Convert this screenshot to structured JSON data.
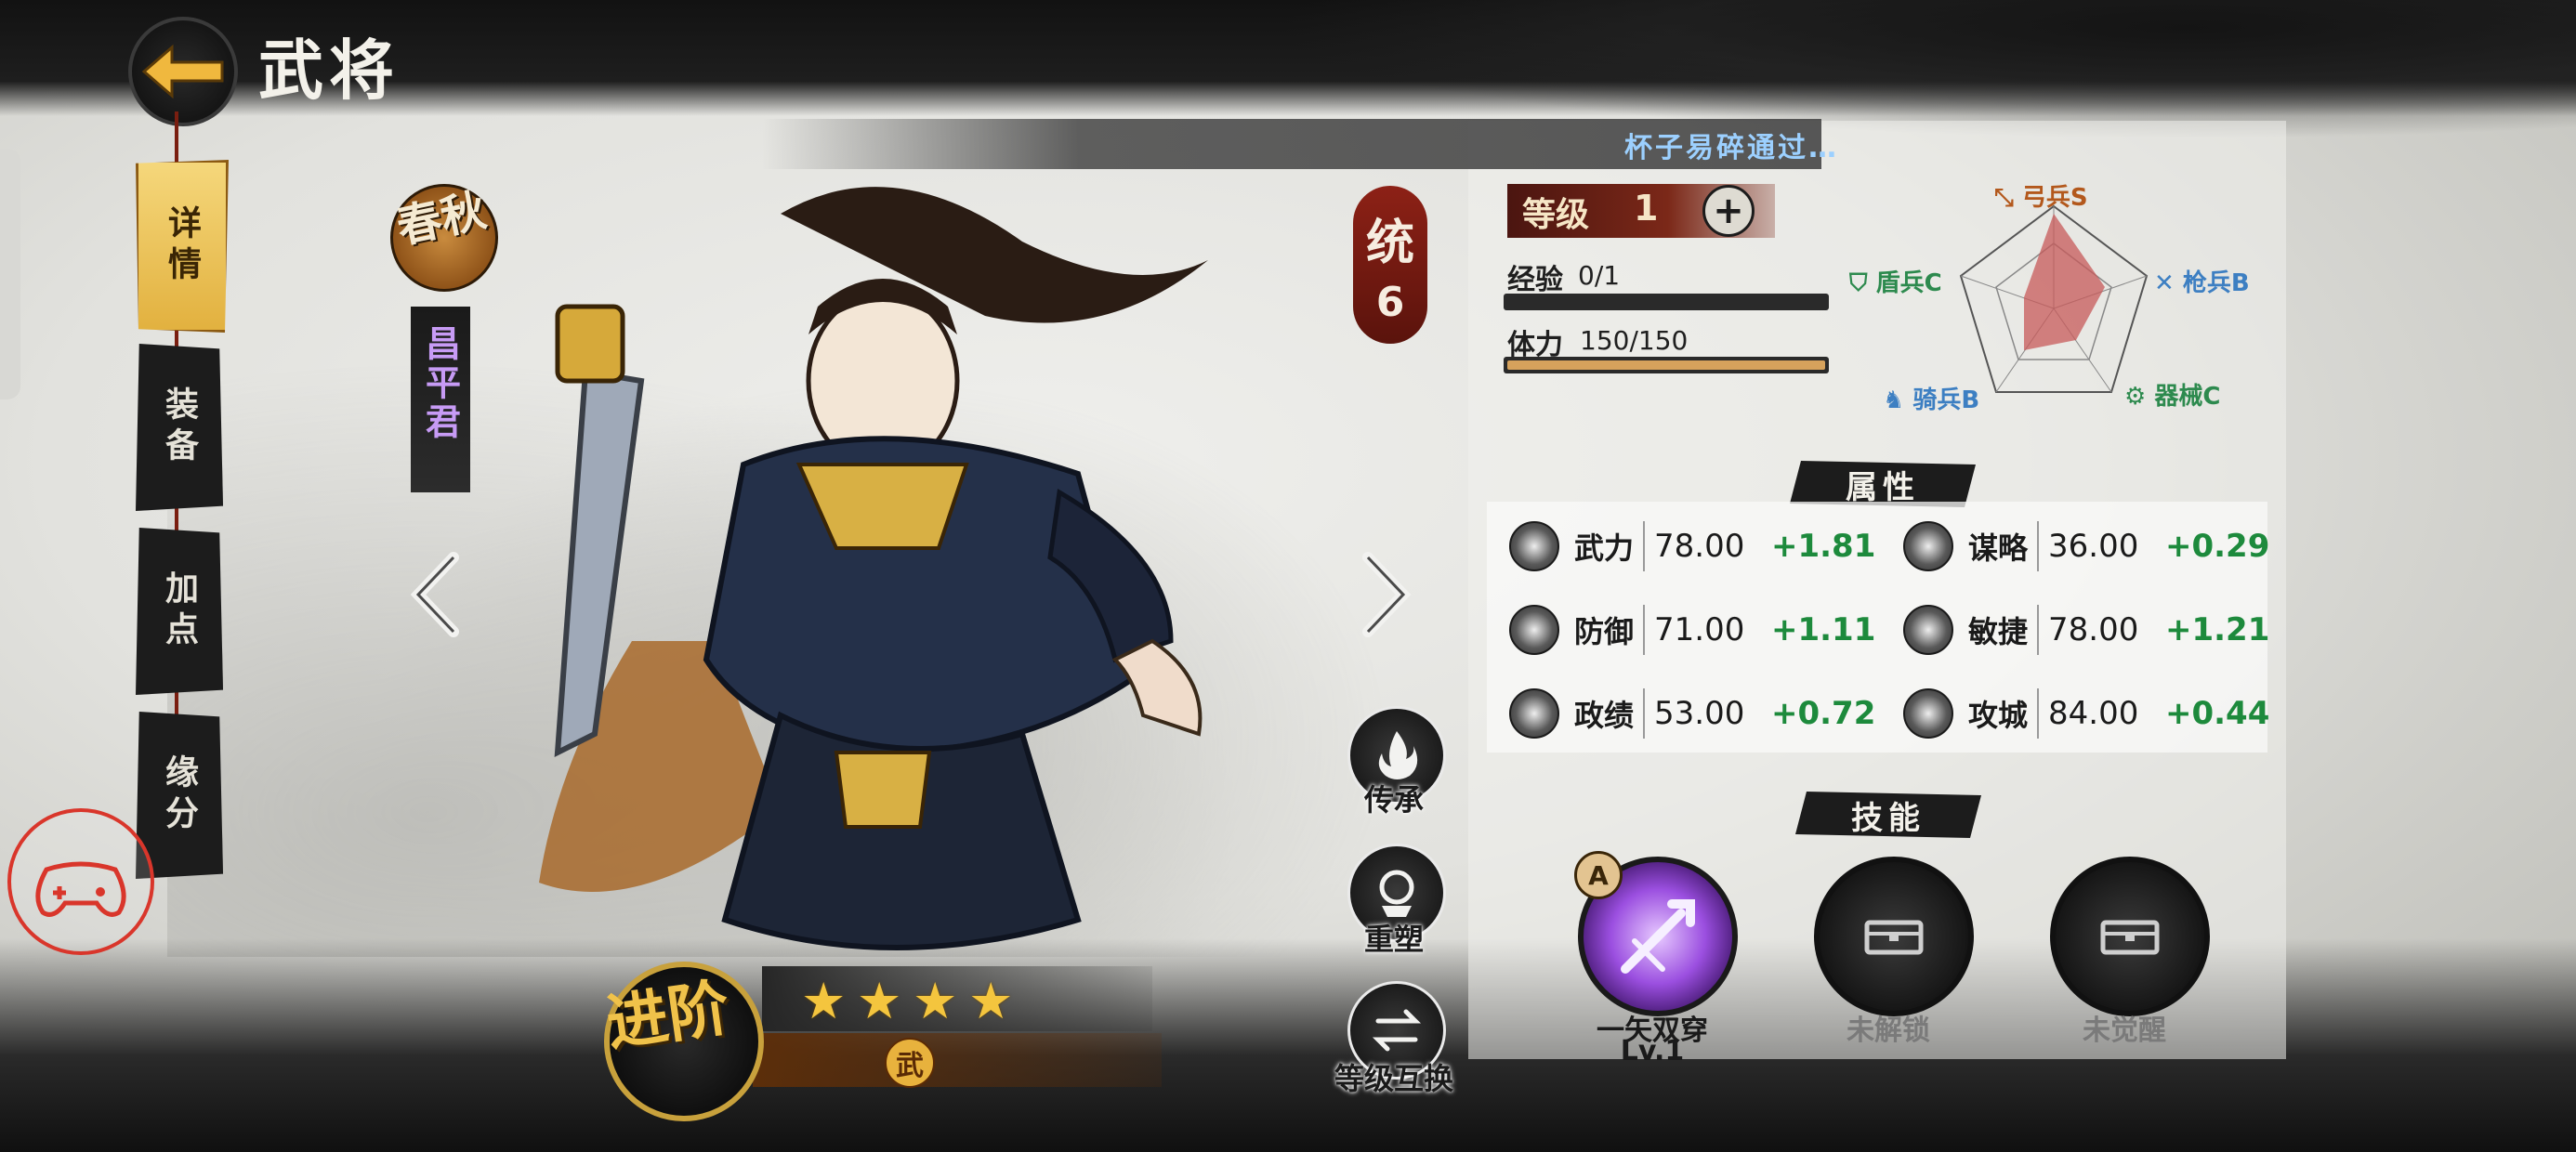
{
  "header": {
    "title": "武将"
  },
  "tabs": [
    {
      "label": "详情",
      "active": true
    },
    {
      "label": "装备",
      "active": false
    },
    {
      "label": "加点",
      "active": false
    },
    {
      "label": "缘分",
      "active": false
    }
  ],
  "hero": {
    "era": "春秋",
    "name": "昌平君",
    "command_label": "统",
    "command_value": "6",
    "stars": 4,
    "type": "武"
  },
  "actions": [
    {
      "label": "传承",
      "icon": "flame-icon"
    },
    {
      "label": "重塑",
      "icon": "rebuild-icon"
    },
    {
      "label": "等级互换",
      "icon": "swap-icon"
    }
  ],
  "advance": {
    "label": "进阶"
  },
  "marquee": {
    "text": "杯子易碎通过…"
  },
  "level": {
    "label": "等级",
    "value": "1"
  },
  "exp": {
    "label": "经验",
    "value": "0/1",
    "ratio": 0.0
  },
  "stamina": {
    "label": "体力",
    "value": "150/150",
    "ratio": 1.0
  },
  "troops": {
    "archer": "弓兵S",
    "spear": "枪兵B",
    "machine": "器械C",
    "cavalry": "骑兵B",
    "shield": "盾兵C",
    "colors": {
      "archer": "#b3581c",
      "spear": "#3d7fc2",
      "machine": "#2d8a4e",
      "cavalry": "#3d7fc2",
      "shield": "#2d8a4e"
    }
  },
  "attributes": {
    "title": "属性",
    "items": [
      {
        "name": "武力",
        "value": "78.00",
        "bonus": "+1.81",
        "icon": "fist-icon"
      },
      {
        "name": "谋略",
        "value": "36.00",
        "bonus": "+0.29",
        "icon": "brain-icon"
      },
      {
        "name": "防御",
        "value": "71.00",
        "bonus": "+1.11",
        "icon": "helmet-icon"
      },
      {
        "name": "敏捷",
        "value": "78.00",
        "bonus": "+1.21",
        "icon": "boot-icon"
      },
      {
        "name": "政绩",
        "value": "53.00",
        "bonus": "+0.72",
        "icon": "crown-icon"
      },
      {
        "name": "攻城",
        "value": "84.00",
        "bonus": "+0.44",
        "icon": "tower-icon"
      }
    ]
  },
  "skills": {
    "title": "技能",
    "items": [
      {
        "name": "一矢双穿",
        "level": "Lv.1",
        "badge": "A",
        "state": "active"
      },
      {
        "name": "未解锁",
        "state": "locked"
      },
      {
        "name": "未觉醒",
        "state": "locked"
      }
    ]
  }
}
